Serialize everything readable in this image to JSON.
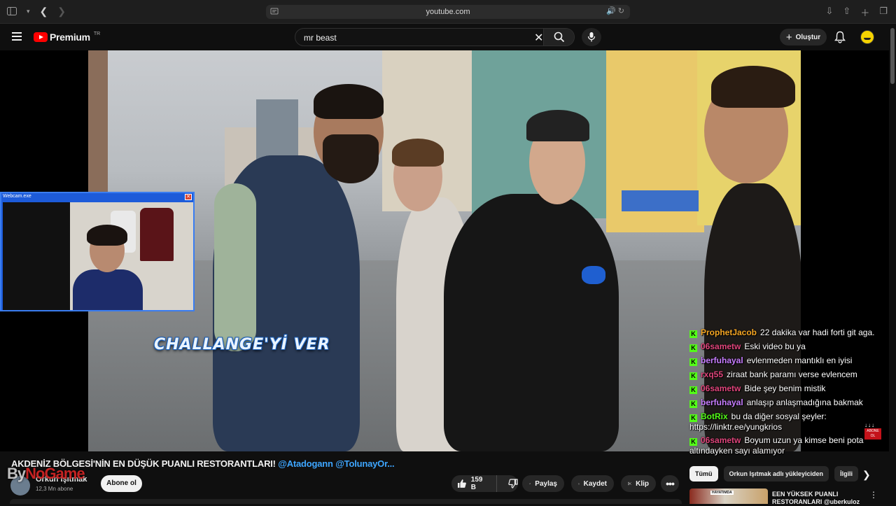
{
  "browser": {
    "url": "youtube.com"
  },
  "header": {
    "logo_text": "Premium",
    "logo_superscript": "TR",
    "search_value": "mr beast",
    "create_label": "Oluştur"
  },
  "video": {
    "overlay_text": "CHALLANGE'Yİ VER",
    "webcam_title": "Webcam.exe",
    "subscribe_tag": "ABONE OL",
    "chat": [
      {
        "user": "ProphetJacob",
        "color": "#f5a623",
        "message": "22 dakika var hadi forti git aga."
      },
      {
        "user": "06sametw",
        "color": "#e0457b",
        "message": "Eski video bu ya"
      },
      {
        "user": "berfuhayal",
        "color": "#c77dff",
        "message": "evlenmeden mantıklı en iyisi"
      },
      {
        "user": "rxq55",
        "color": "#e0457b",
        "message": "ziraat bank paramı verse evlencem"
      },
      {
        "user": "06sametw",
        "color": "#e0457b",
        "message": "Bide şey benim mistik"
      },
      {
        "user": "berfuhayal",
        "color": "#c77dff",
        "message": "anlaşıp anlaşmadığına bakmak"
      },
      {
        "user": "BotRix",
        "color": "#53fc18",
        "message": "bu da diğer sosyal şeyler: https://linktr.ee/yungkrios"
      },
      {
        "user": "06sametw",
        "color": "#e0457b",
        "message": "Boyum uzun ya kimse beni pota altındayken sayı alamıyor"
      }
    ]
  },
  "details": {
    "title": "AKDENİZ BÖLGESİ'NİN EN DÜŞÜK PUANLI RESTORANTLARI!",
    "title_tags": "@Atadogann @TolunayOr...",
    "channel_name": "Orkun Işıtmak",
    "subscribers": "12,3 Mn abone",
    "watermark_a": "By",
    "watermark_b": "NoGame",
    "subscribe_label": "Abone ol",
    "likes": "159 B",
    "share_label": "Paylaş",
    "save_label": "Kaydet",
    "clip_label": "Klip"
  },
  "sidebar": {
    "chips": [
      "Tümü",
      "Orkun Işıtmak adlı yükleyiciden",
      "İlgili"
    ],
    "rec_title": "EEN YÜKSEK PUANLI RESTORANLARI @uberkuloz",
    "rec_thumb_label": "HAYATIMDA"
  }
}
